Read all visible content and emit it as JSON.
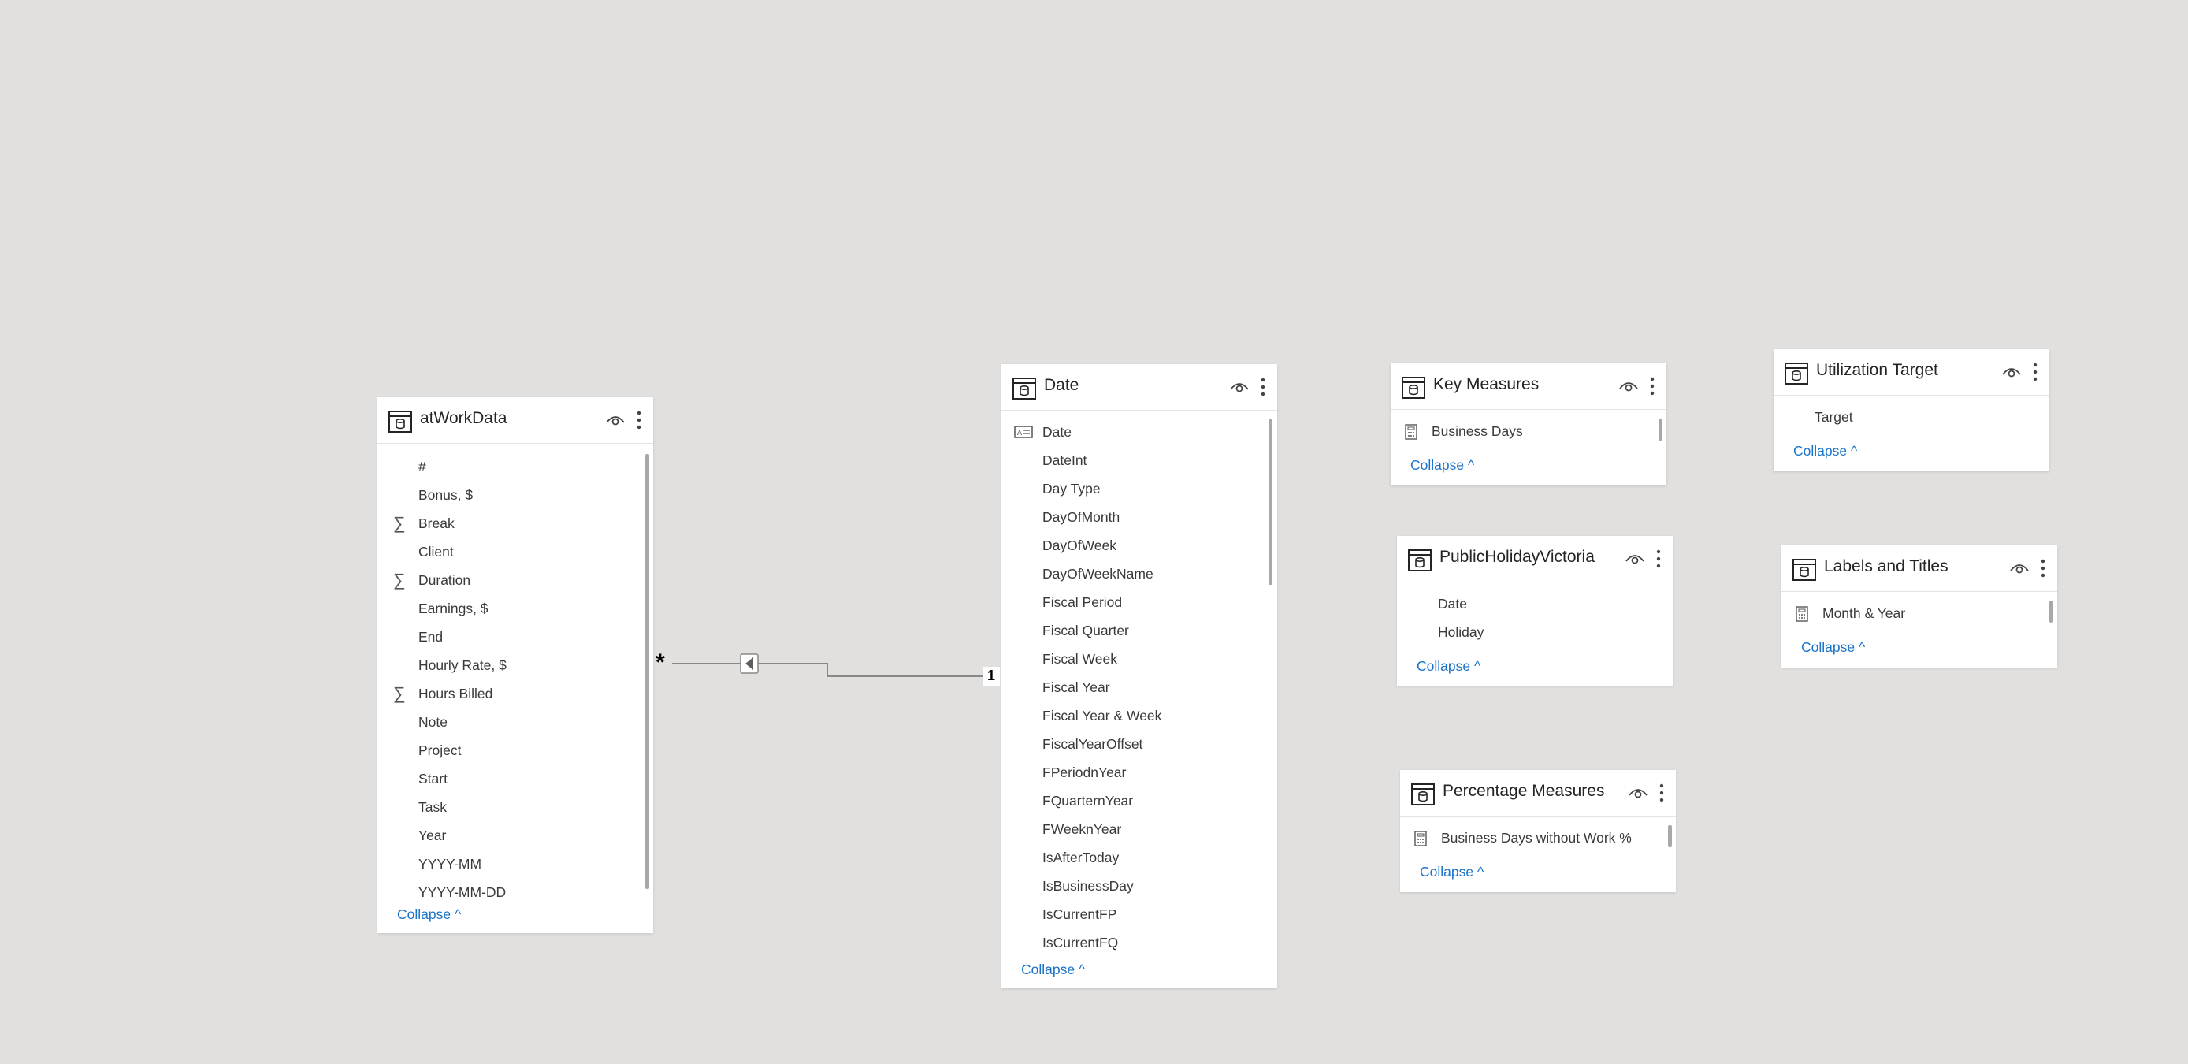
{
  "diagram": {
    "relationship": {
      "from_cardinality": "*",
      "to_cardinality": "1"
    }
  },
  "cards": {
    "atwork": {
      "title": "atWorkData",
      "fields": [
        {
          "label": "#",
          "icon": ""
        },
        {
          "label": "Bonus, $",
          "icon": ""
        },
        {
          "label": "Break",
          "icon": "sigma-icon"
        },
        {
          "label": "Client",
          "icon": ""
        },
        {
          "label": "Duration",
          "icon": "sigma-icon"
        },
        {
          "label": "Earnings, $",
          "icon": ""
        },
        {
          "label": "End",
          "icon": ""
        },
        {
          "label": "Hourly Rate, $",
          "icon": ""
        },
        {
          "label": "Hours Billed",
          "icon": "sigma-icon"
        },
        {
          "label": "Note",
          "icon": ""
        },
        {
          "label": "Project",
          "icon": ""
        },
        {
          "label": "Start",
          "icon": ""
        },
        {
          "label": "Task",
          "icon": ""
        },
        {
          "label": "Year",
          "icon": ""
        },
        {
          "label": "YYYY-MM",
          "icon": ""
        },
        {
          "label": "YYYY-MM-DD",
          "icon": ""
        }
      ],
      "collapse": "Collapse"
    },
    "date": {
      "title": "Date",
      "fields": [
        {
          "label": "Date",
          "icon": "text-field-icon"
        },
        {
          "label": "DateInt",
          "icon": ""
        },
        {
          "label": "Day Type",
          "icon": ""
        },
        {
          "label": "DayOfMonth",
          "icon": ""
        },
        {
          "label": "DayOfWeek",
          "icon": ""
        },
        {
          "label": "DayOfWeekName",
          "icon": ""
        },
        {
          "label": "Fiscal Period",
          "icon": ""
        },
        {
          "label": "Fiscal Quarter",
          "icon": ""
        },
        {
          "label": "Fiscal Week",
          "icon": ""
        },
        {
          "label": "Fiscal Year",
          "icon": ""
        },
        {
          "label": "Fiscal Year & Week",
          "icon": ""
        },
        {
          "label": "FiscalYearOffset",
          "icon": ""
        },
        {
          "label": "FPeriodnYear",
          "icon": ""
        },
        {
          "label": "FQuarternYear",
          "icon": ""
        },
        {
          "label": "FWeeknYear",
          "icon": ""
        },
        {
          "label": "IsAfterToday",
          "icon": ""
        },
        {
          "label": "IsBusinessDay",
          "icon": ""
        },
        {
          "label": "IsCurrentFP",
          "icon": ""
        },
        {
          "label": "IsCurrentFQ",
          "icon": ""
        }
      ],
      "collapse": "Collapse"
    },
    "key_measures": {
      "title": "Key Measures",
      "fields": [
        {
          "label": "Business Days",
          "icon": "calculator-icon"
        }
      ],
      "collapse": "Collapse"
    },
    "public_holiday": {
      "title": "PublicHolidayVictoria",
      "fields": [
        {
          "label": "Date",
          "icon": ""
        },
        {
          "label": "Holiday",
          "icon": ""
        }
      ],
      "collapse": "Collapse"
    },
    "percentage_measures": {
      "title": "Percentage Measures",
      "fields": [
        {
          "label": "Business Days without Work %",
          "icon": "calculator-icon"
        }
      ],
      "collapse": "Collapse"
    },
    "utilization_target": {
      "title": "Utilization Target",
      "fields": [
        {
          "label": "Target",
          "icon": ""
        }
      ],
      "collapse": "Collapse"
    },
    "labels_titles": {
      "title": "Labels and Titles",
      "fields": [
        {
          "label": "Month & Year",
          "icon": "calculator-icon"
        }
      ],
      "collapse": "Collapse"
    }
  },
  "colors": {
    "canvas": "#e2e0de",
    "card": "#ffffff",
    "link": "#1a73c8",
    "text": "#3b3a39",
    "line": "#8a8886"
  }
}
